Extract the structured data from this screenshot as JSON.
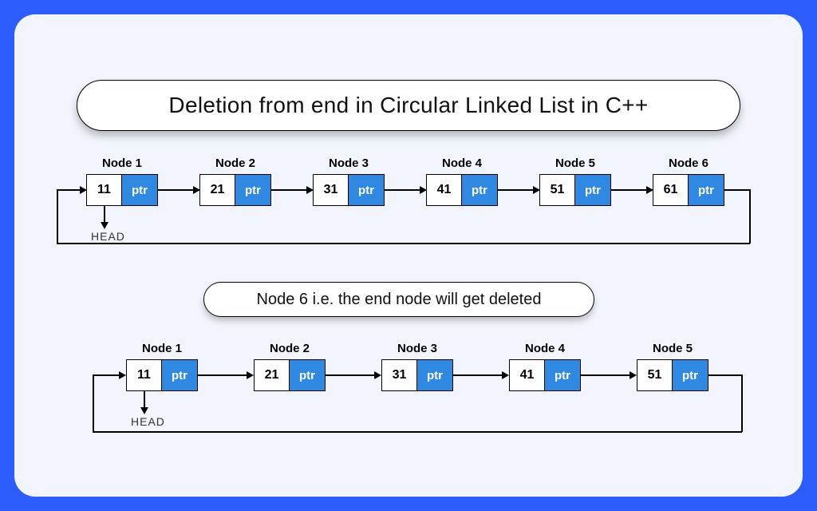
{
  "title": "Deletion from end in Circular Linked List in C++",
  "caption": "Node 6 i.e. the end node will get deleted",
  "head_label": "HEAD",
  "ptr_label": "ptr",
  "row1": {
    "nodes": [
      {
        "label": "Node 1",
        "value": "11"
      },
      {
        "label": "Node 2",
        "value": "21"
      },
      {
        "label": "Node 3",
        "value": "31"
      },
      {
        "label": "Node 4",
        "value": "41"
      },
      {
        "label": "Node 5",
        "value": "51"
      },
      {
        "label": "Node 6",
        "value": "61"
      }
    ]
  },
  "row2": {
    "nodes": [
      {
        "label": "Node 1",
        "value": "11"
      },
      {
        "label": "Node 2",
        "value": "21"
      },
      {
        "label": "Node 3",
        "value": "31"
      },
      {
        "label": "Node 4",
        "value": "41"
      },
      {
        "label": "Node 5",
        "value": "51"
      }
    ]
  },
  "colors": {
    "ptr_bg": "#2f89e3",
    "frame": "#2d5dfc",
    "canvas": "#f2f5fd"
  }
}
